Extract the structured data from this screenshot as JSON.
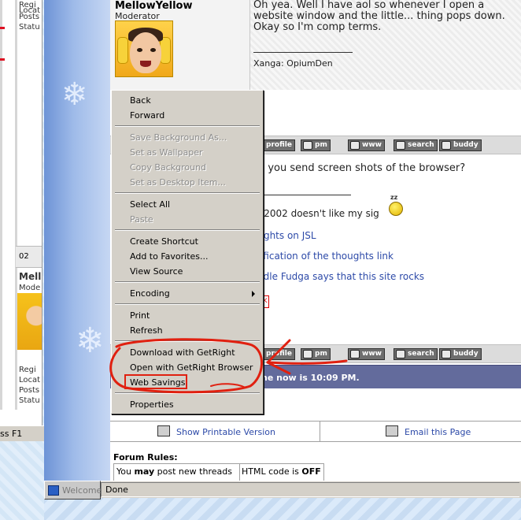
{
  "back_window": {
    "labels": [
      "Regi",
      "Locat",
      "Posts",
      "Statu"
    ],
    "labels2": [
      "Regi",
      "Locat",
      "Posts",
      "Statu"
    ],
    "date_fragment": "02",
    "username_fragment": "Mell",
    "title_fragment": "Mode",
    "statusbar_fragment": "ss F1"
  },
  "post1": {
    "username": "MellowYellow",
    "user_title": "Moderator",
    "text": "Oh yea. Well I have aol so whenever I open a website window and the little... thing pops down. Okay so I'm comp terms.",
    "signature": "Xanga: OpiumDen"
  },
  "buttons": {
    "profile": "profile",
    "pm": "pm",
    "www": "www",
    "search": "search",
    "buddy": "buddy"
  },
  "post2": {
    "line1": "an you send screen shots of the browser?",
    "sig_line": "bu2002 doesn't like my sig",
    "link1": "oughts on JSL",
    "link2": "stification of the thoughts link",
    "link3": "oodle Fudga says that this site rocks",
    "quick_fragment": "k"
  },
  "time_bar": {
    "text": "ne now is 10:09 PM."
  },
  "footer": {
    "print_label": "Show Printable Version",
    "email_label": "Email this Page"
  },
  "rules": {
    "title": "Forum Rules:",
    "left_prefix": "You ",
    "left_bold": "may",
    "left_suffix": " post new threads",
    "right_prefix": "HTML code is ",
    "right_bold": "OFF"
  },
  "context_menu": {
    "items": [
      {
        "label": "Back",
        "enabled": true
      },
      {
        "label": "Forward",
        "enabled": true
      },
      {
        "label": "Save Background As...",
        "enabled": false
      },
      {
        "label": "Set as Wallpaper",
        "enabled": false
      },
      {
        "label": "Copy Background",
        "enabled": false
      },
      {
        "label": "Set as Desktop Item...",
        "enabled": false
      },
      {
        "label": "Select All",
        "enabled": true
      },
      {
        "label": "Paste",
        "enabled": false
      },
      {
        "label": "Create Shortcut",
        "enabled": true
      },
      {
        "label": "Add to Favorites...",
        "enabled": true
      },
      {
        "label": "View Source",
        "enabled": true
      },
      {
        "label": "Encoding",
        "enabled": true
      },
      {
        "label": "Print",
        "enabled": true
      },
      {
        "label": "Refresh",
        "enabled": true
      },
      {
        "label": "Download with GetRight",
        "enabled": true
      },
      {
        "label": "Open with GetRight Browser",
        "enabled": true
      },
      {
        "label": "Web Savings",
        "enabled": true
      },
      {
        "label": "Properties",
        "enabled": true
      }
    ]
  },
  "status_bar": {
    "text": "Done"
  },
  "taskbar": {
    "label": "Welcome"
  },
  "colors": {
    "annotation_red": "#e02010",
    "time_bar": "#636b9c",
    "link_blue": "#2d4aa8"
  }
}
